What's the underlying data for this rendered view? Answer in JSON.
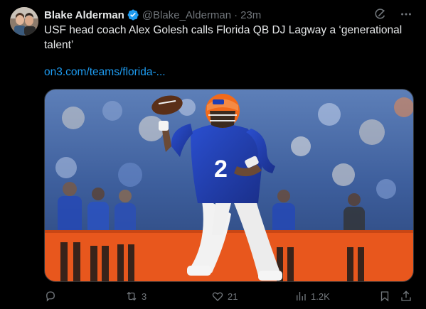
{
  "author": {
    "name": "Blake Alderman",
    "handle": "@Blake_Alderman",
    "separator": "·",
    "time": "23m"
  },
  "tweet": {
    "text": "USF head coach Alex Golesh calls Florida QB DJ Lagway a ‘generational talent’",
    "link": "on3.com/teams/florida-..."
  },
  "media": {
    "subject": "Florida quarterback in blue jersey number 2 throwing a football",
    "jersey_number": "2"
  },
  "actions": {
    "reply_count": "",
    "retweet_count": "3",
    "like_count": "21",
    "views_count": "1.2K"
  },
  "icons": {
    "verified": "verified-badge-icon",
    "grok": "grok-icon",
    "more": "more-icon",
    "reply": "reply-icon",
    "retweet": "retweet-icon",
    "like": "like-icon",
    "views": "views-icon",
    "bookmark": "bookmark-icon",
    "share": "share-icon"
  },
  "colors": {
    "background": "#000000",
    "text": "#e7e9ea",
    "muted": "#71767b",
    "link": "#1d9bf0",
    "jersey_blue": "#1f3fb5",
    "helmet_orange": "#f26a1b",
    "wall_orange": "#e8571d"
  }
}
